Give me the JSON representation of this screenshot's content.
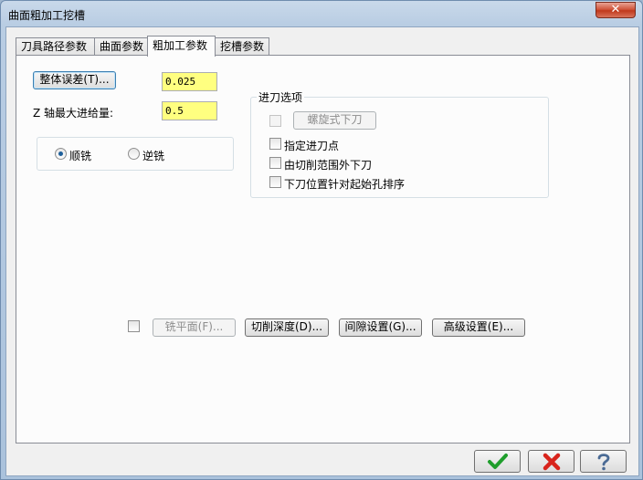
{
  "window": {
    "title": "曲面粗加工挖槽",
    "close_glyph": "✕"
  },
  "tabs": [
    {
      "label": "刀具路径参数"
    },
    {
      "label": "曲面参数"
    },
    {
      "label": "粗加工参数"
    },
    {
      "label": "挖槽参数"
    }
  ],
  "tolerance": {
    "button_label": "整体误差(T)...",
    "value": "0.025"
  },
  "z_step": {
    "label": "Z 轴最大进给量:",
    "value": "0.5"
  },
  "milling_direction": {
    "options": [
      {
        "label": "顺铣",
        "selected": true
      },
      {
        "label": "逆铣",
        "selected": false
      }
    ]
  },
  "entry_options": {
    "title": "进刀选项",
    "helix_button": "螺旋式下刀",
    "items": [
      {
        "label": "指定进刀点",
        "checked": false
      },
      {
        "label": "由切削范围外下刀",
        "checked": false
      },
      {
        "label": "下刀位置针对起始孔排序",
        "checked": false
      }
    ]
  },
  "bottom_buttons": {
    "face_mill": "铣平面(F)...",
    "cut_depth": "切削深度(D)...",
    "gap_settings": "间隙设置(G)...",
    "advanced": "高级设置(E)..."
  },
  "colors": {
    "input_bg": "#ffff80",
    "ok_green": "#1f9e2c",
    "cancel_red": "#d8241c",
    "help_blue": "#4a6a94"
  },
  "icons": {
    "ok": "checkmark-icon",
    "cancel": "cross-icon",
    "help": "question-mark-icon"
  }
}
